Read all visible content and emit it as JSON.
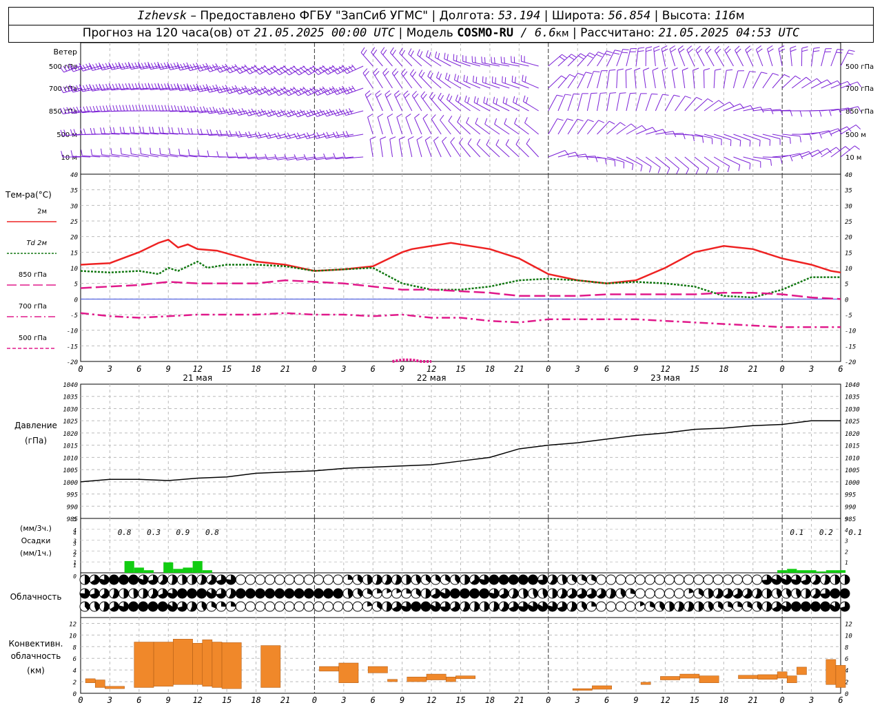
{
  "header": {
    "station": "Izhevsk",
    "dash": " – ",
    "provider_label": "Предоставлено ФГБУ \"ЗапСиб УГМС\"",
    "sep": " | ",
    "lon_label": "Долгота: ",
    "lon_value": "53.194",
    "lat_label": "Широта: ",
    "lat_value": "56.854",
    "alt_label": "Высота: ",
    "alt_value": "116",
    "alt_unit": "м",
    "forecast_label": "Прогноз на 120 часа(ов) от ",
    "forecast_from": "21.05.2025 00:00 UTC",
    "model_label": " | Модель ",
    "model_name": "COSMO-RU",
    "model_res_sep": " / ",
    "model_res": "6.6",
    "model_res_unit": "км",
    "calc_label": " | Рассчитано: ",
    "calc_value": "21.05.2025 04:53 UTC"
  },
  "wind_panel": {
    "title": "Ветер",
    "levels": [
      "500 гПа",
      "700 гПа",
      "850 гПа",
      "500 м",
      "10  м"
    ],
    "color": "#7a1fd6"
  },
  "temp_panel": {
    "title": "Тем-ра(°C)",
    "legend": [
      {
        "label": "2м",
        "style": "solid",
        "color": "#ee2222"
      },
      {
        "label": "Td  2м",
        "style": "dotted",
        "color": "#117711"
      },
      {
        "label": "850 гПа",
        "style": "dashed",
        "color": "#e0188a"
      },
      {
        "label": "700 гПа",
        "style": "dashdot",
        "color": "#e0188a"
      },
      {
        "label": "500 гПа",
        "style": "dashed-thin",
        "color": "#e0188a"
      }
    ],
    "y_ticks": [
      "40",
      "35",
      "30",
      "25",
      "20",
      "15",
      "10",
      "5",
      "0",
      "-5",
      "-10",
      "-15",
      "-20"
    ]
  },
  "time_axis": {
    "hour_labels": [
      "0",
      "3",
      "6",
      "9",
      "12",
      "15",
      "18",
      "21",
      "0",
      "3",
      "6",
      "9",
      "12",
      "15",
      "18",
      "21",
      "0",
      "3",
      "6",
      "9",
      "12",
      "15",
      "18",
      "21",
      "0",
      "3",
      "6"
    ],
    "days": [
      "21 мая",
      "22 мая",
      "23 мая"
    ]
  },
  "pressure_panel": {
    "title_line1": "Давление",
    "title_line2": "(гПа)",
    "y_ticks": [
      "1040",
      "1035",
      "1030",
      "1025",
      "1020",
      "1015",
      "1010",
      "1005",
      "1000",
      "995",
      "990",
      "985"
    ]
  },
  "precip_panel": {
    "label_top": "(мм/3ч.)",
    "label_mid": "Осадки",
    "label_bot": "(мм/1ч.)",
    "y_ticks_top": [
      "5",
      "4",
      "3",
      "2",
      "1"
    ],
    "y_ticks_bot": [
      "4",
      "3",
      "2",
      "1",
      "0"
    ],
    "amounts": [
      {
        "hour": 6,
        "text": "0.8"
      },
      {
        "hour": 9,
        "text": "0.3"
      },
      {
        "hour": 12,
        "text": "0.9"
      },
      {
        "hour": 15,
        "text": "0.8"
      },
      {
        "hour": 75,
        "text": "0.1"
      },
      {
        "hour": 78,
        "text": "0.2"
      },
      {
        "hour": 81,
        "text": "0.1"
      }
    ],
    "color": "#11cc11"
  },
  "cloud_panel": {
    "title": "Облачность"
  },
  "conv_panel": {
    "title_line1": "Конвективн.",
    "title_line2": "облачность",
    "title_line3": "(км)",
    "y_ticks": [
      "12",
      "10",
      "8",
      "6",
      "4",
      "2",
      "0"
    ],
    "color": "#f0882a"
  },
  "chart_data": [
    {
      "type": "line",
      "title": "Тем-ра(°C)",
      "ylim": [
        -20,
        40
      ],
      "x_hours_step": 1,
      "series": [
        {
          "name": "2м",
          "x": [
            0,
            3,
            6,
            8,
            9,
            10,
            11,
            12,
            14,
            18,
            21,
            24,
            27,
            30,
            33,
            34,
            36,
            38,
            42,
            45,
            48,
            51,
            54,
            57,
            60,
            63,
            66,
            69,
            72,
            75,
            77,
            78
          ],
          "y": [
            11,
            11.5,
            15,
            18,
            19,
            16.5,
            17.5,
            16,
            15.5,
            12,
            11,
            9,
            9.5,
            10.5,
            15,
            16,
            17,
            18,
            16,
            13,
            8,
            6,
            5,
            6,
            10,
            15,
            17,
            16,
            13,
            11,
            9,
            8.5
          ]
        },
        {
          "name": "Td  2м",
          "x": [
            0,
            3,
            6,
            8,
            9,
            10,
            12,
            13,
            15,
            18,
            21,
            24,
            27,
            30,
            33,
            36,
            39,
            42,
            45,
            48,
            51,
            54,
            57,
            60,
            63,
            66,
            69,
            72,
            75,
            78
          ],
          "y": [
            9,
            8.5,
            9,
            8,
            10,
            9,
            12,
            10,
            11,
            11,
            10.5,
            9,
            9.5,
            10,
            5,
            3,
            3,
            4,
            6,
            6.5,
            6,
            5,
            5.5,
            5,
            4,
            1,
            0.5,
            3,
            7,
            7
          ]
        },
        {
          "name": "850 гПа",
          "x": [
            0,
            6,
            9,
            12,
            15,
            18,
            21,
            24,
            27,
            30,
            33,
            36,
            39,
            42,
            45,
            48,
            51,
            54,
            57,
            60,
            63,
            66,
            69,
            72,
            75,
            78
          ],
          "y": [
            3.5,
            4.5,
            5.5,
            5,
            5,
            5,
            6,
            5.5,
            5,
            4,
            3,
            3,
            2.5,
            2,
            1,
            1,
            1,
            1.5,
            1.5,
            1.5,
            1.5,
            2,
            2,
            1.5,
            0.5,
            0
          ]
        },
        {
          "name": "700 гПа",
          "x": [
            0,
            3,
            6,
            9,
            12,
            15,
            18,
            21,
            24,
            27,
            30,
            33,
            36,
            39,
            42,
            45,
            48,
            51,
            54,
            57,
            60,
            63,
            66,
            69,
            72,
            75,
            78
          ],
          "y": [
            -4.5,
            -5.5,
            -6,
            -5.5,
            -5,
            -5,
            -5,
            -4.5,
            -5,
            -5,
            -5.5,
            -5,
            -6,
            -6,
            -7,
            -7.5,
            -6.5,
            -6.5,
            -6.5,
            -6.5,
            -7,
            -7.5,
            -8,
            -8.5,
            -9,
            -9,
            -9
          ]
        },
        {
          "name": "500 гПа",
          "x": [
            32,
            33,
            34,
            35,
            36
          ],
          "y": [
            -20,
            -19.5,
            -19.5,
            -20,
            -20
          ]
        }
      ]
    },
    {
      "type": "line",
      "title": "Давление",
      "ylim": [
        985,
        1040
      ],
      "series": [
        {
          "name": "",
          "x": [
            0,
            3,
            6,
            9,
            12,
            15,
            18,
            21,
            24,
            27,
            30,
            33,
            36,
            39,
            42,
            45,
            48,
            51,
            54,
            57,
            60,
            63,
            66,
            69,
            72,
            75,
            78
          ],
          "y": [
            1000,
            1001,
            1001,
            1000.5,
            1001.5,
            1002,
            1003.5,
            1004,
            1004.5,
            1005.5,
            1006,
            1006.5,
            1007,
            1008.5,
            1010,
            1013.5,
            1015,
            1016,
            1017.5,
            1019,
            1020,
            1021.5,
            1022,
            1023,
            1023.5,
            1025,
            1025
          ]
        }
      ]
    },
    {
      "type": "bar",
      "title": "Осадки",
      "x": [
        5,
        6,
        7,
        9,
        10,
        11,
        12,
        13,
        72,
        73,
        74,
        75,
        76,
        77,
        78
      ],
      "values": [
        0.9,
        0.4,
        0.2,
        0.8,
        0.3,
        0.4,
        0.9,
        0.2,
        0.2,
        0.3,
        0.2,
        0.2,
        0.1,
        0.2,
        0.2
      ]
    },
    {
      "type": "bar",
      "title": "Конвективн. облачность",
      "ylim": [
        0,
        13
      ],
      "ranges": [
        {
          "x0": 0.5,
          "x1": 1.5,
          "base": 1.8,
          "top": 2.5
        },
        {
          "x0": 1.5,
          "x1": 2.5,
          "base": 1.0,
          "top": 2.3
        },
        {
          "x0": 2.5,
          "x1": 4.5,
          "base": 0.8,
          "top": 1.2
        },
        {
          "x0": 5.5,
          "x1": 7.5,
          "base": 1.0,
          "top": 8.8
        },
        {
          "x0": 7.5,
          "x1": 9.5,
          "base": 1.2,
          "top": 8.8
        },
        {
          "x0": 9.5,
          "x1": 11.5,
          "base": 1.5,
          "top": 9.3
        },
        {
          "x0": 11.5,
          "x1": 12.5,
          "base": 1.5,
          "top": 8.6
        },
        {
          "x0": 12.5,
          "x1": 13.5,
          "base": 1.2,
          "top": 9.2
        },
        {
          "x0": 13.5,
          "x1": 14.5,
          "base": 1.0,
          "top": 8.8
        },
        {
          "x0": 14.5,
          "x1": 16.5,
          "base": 0.8,
          "top": 8.7
        },
        {
          "x0": 18.5,
          "x1": 20.5,
          "base": 1.0,
          "top": 8.2
        },
        {
          "x0": 24.5,
          "x1": 26.5,
          "base": 3.8,
          "top": 4.6
        },
        {
          "x0": 26.5,
          "x1": 28.5,
          "base": 1.8,
          "top": 5.2
        },
        {
          "x0": 29.5,
          "x1": 31.5,
          "base": 3.5,
          "top": 4.6
        },
        {
          "x0": 31.5,
          "x1": 32.5,
          "base": 2.0,
          "top": 2.4
        },
        {
          "x0": 33.5,
          "x1": 35.5,
          "base": 2.0,
          "top": 2.8
        },
        {
          "x0": 35.5,
          "x1": 37.5,
          "base": 2.3,
          "top": 3.3
        },
        {
          "x0": 37.5,
          "x1": 38.5,
          "base": 2.0,
          "top": 2.8
        },
        {
          "x0": 38.5,
          "x1": 40.5,
          "base": 2.5,
          "top": 3.0
        },
        {
          "x0": 50.5,
          "x1": 52.5,
          "base": 0.5,
          "top": 0.8
        },
        {
          "x0": 52.5,
          "x1": 54.5,
          "base": 0.7,
          "top": 1.3
        },
        {
          "x0": 57.5,
          "x1": 58.5,
          "base": 1.5,
          "top": 1.9
        },
        {
          "x0": 59.5,
          "x1": 61.5,
          "base": 2.3,
          "top": 2.9
        },
        {
          "x0": 61.5,
          "x1": 63.5,
          "base": 2.6,
          "top": 3.3
        },
        {
          "x0": 63.5,
          "x1": 65.5,
          "base": 1.8,
          "top": 3.0
        },
        {
          "x0": 67.5,
          "x1": 69.5,
          "base": 2.5,
          "top": 3.1
        },
        {
          "x0": 69.5,
          "x1": 71.5,
          "base": 2.4,
          "top": 3.2
        },
        {
          "x0": 71.5,
          "x1": 72.5,
          "base": 2.6,
          "top": 3.7
        },
        {
          "x0": 72.5,
          "x1": 73.5,
          "base": 1.8,
          "top": 3.0
        },
        {
          "x0": 73.5,
          "x1": 74.5,
          "base": 3.2,
          "top": 4.5
        },
        {
          "x0": 76.5,
          "x1": 77.5,
          "base": 1.5,
          "top": 5.8
        },
        {
          "x0": 77.5,
          "x1": 78.5,
          "base": 1.0,
          "top": 4.8
        }
      ]
    }
  ]
}
